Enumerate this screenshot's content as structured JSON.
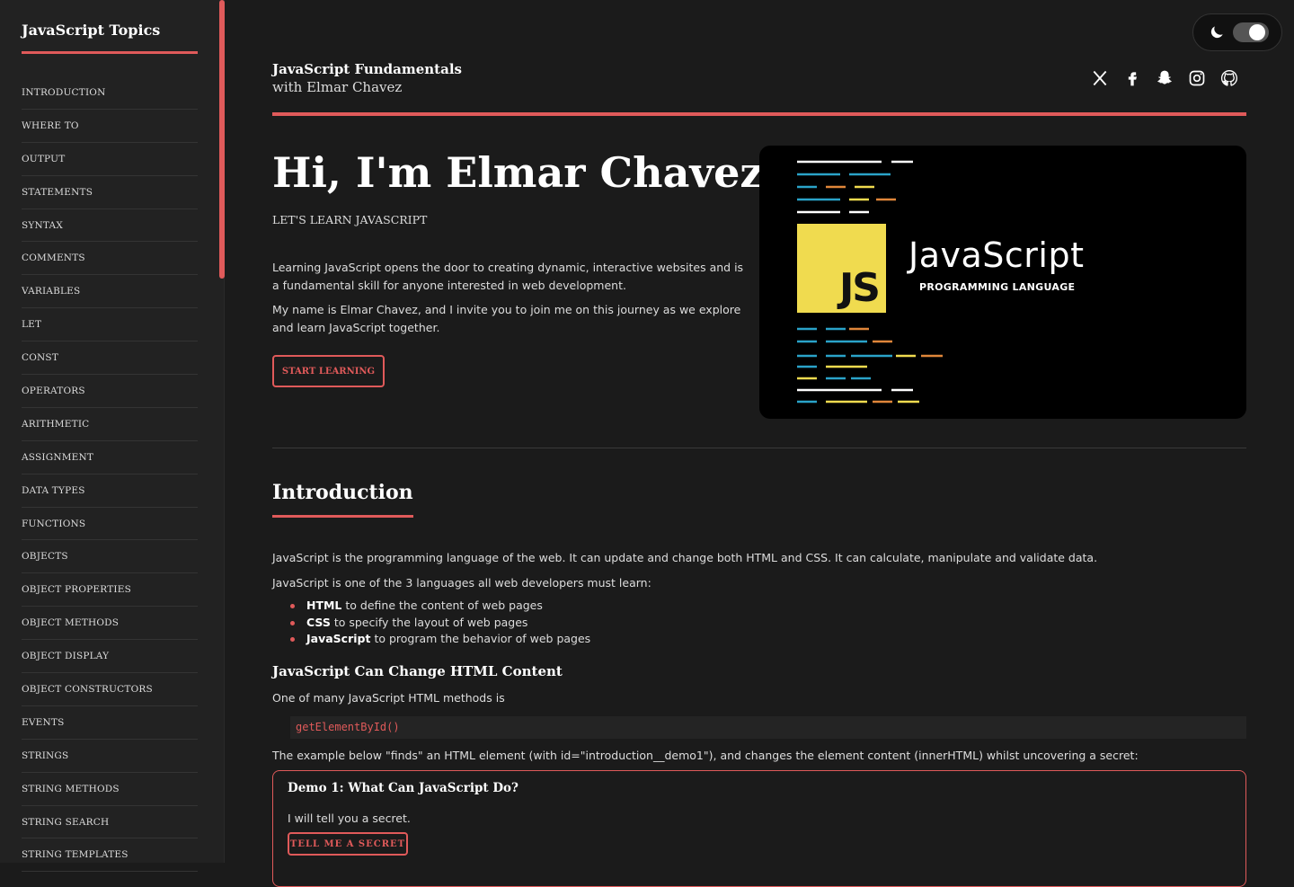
{
  "sidebar": {
    "title": "JavaScript Topics",
    "items": [
      "INTRODUCTION",
      "WHERE TO",
      "OUTPUT",
      "STATEMENTS",
      "SYNTAX",
      "COMMENTS",
      "VARIABLES",
      "LET",
      "CONST",
      "OPERATORS",
      "ARITHMETIC",
      "ASSIGNMENT",
      "DATA TYPES",
      "FUNCTIONS",
      "OBJECTS",
      "OBJECT PROPERTIES",
      "OBJECT METHODS",
      "OBJECT DISPLAY",
      "OBJECT CONSTRUCTORS",
      "EVENTS",
      "STRINGS",
      "STRING METHODS",
      "STRING SEARCH",
      "STRING TEMPLATES"
    ]
  },
  "header": {
    "title": "JavaScript Fundamentals",
    "subtitle": "with Elmar Chavez",
    "socials": [
      "x-icon",
      "facebook-icon",
      "snapchat-icon",
      "instagram-icon",
      "github-icon"
    ]
  },
  "hero": {
    "heading": "Hi, I'm Elmar Chavez",
    "tagline": "LET'S LEARN JAVASCRIPT",
    "p1": "Learning JavaScript opens the door to creating dynamic, interactive websites and is a fundamental skill for anyone interested in web development.",
    "p2": "My name is Elmar Chavez, and I invite you to join me on this journey as we explore and learn JavaScript together.",
    "button": "START LEARNING",
    "image": {
      "badge": "JS",
      "word": "JavaScript",
      "sub": "PROGRAMMING LANGUAGE"
    }
  },
  "intro": {
    "heading": "Introduction",
    "p1": "JavaScript is the programming language of the web. It can update and change both HTML and CSS. It can calculate, manipulate and validate data.",
    "p2": "JavaScript is one of the 3 languages all web developers must learn:",
    "list": [
      {
        "bold": "HTML",
        "text": " to define the content of web pages"
      },
      {
        "bold": "CSS",
        "text": " to specify the layout of web pages"
      },
      {
        "bold": "JavaScript",
        "text": " to program the behavior of web pages"
      }
    ],
    "h3": "JavaScript Can Change HTML Content",
    "p3": "One of many JavaScript HTML methods is",
    "code": "getElementById()",
    "p4": "The example below \"finds\" an HTML element (with id=\"introduction__demo1\"), and changes the element content (innerHTML) whilst uncovering a secret:",
    "demo": {
      "title": "Demo 1: What Can JavaScript Do?",
      "text": "I will tell you a secret.",
      "button": "TELL ME A SECRET"
    }
  },
  "colors": {
    "accent": "#e05a5a",
    "background": "#1b1b1b",
    "sidebar": "#222222",
    "js_yellow": "#f0db4f"
  }
}
